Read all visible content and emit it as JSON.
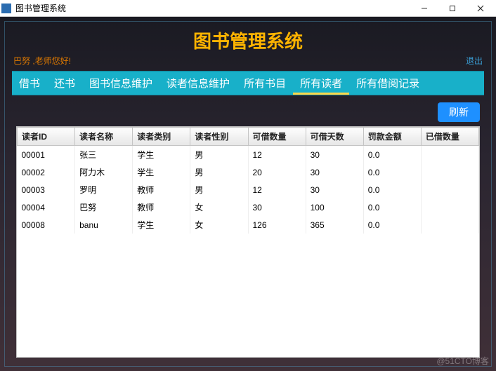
{
  "window": {
    "title": "图书管理系统"
  },
  "app": {
    "title": "图书管理系统",
    "greeting": "巴努 ,老师您好!",
    "exit": "退出"
  },
  "tabs": {
    "items": [
      {
        "label": "借书"
      },
      {
        "label": "还书"
      },
      {
        "label": "图书信息维护"
      },
      {
        "label": "读者信息维护"
      },
      {
        "label": "所有书目"
      },
      {
        "label": "所有读者"
      },
      {
        "label": "所有借阅记录"
      }
    ],
    "active_index": 5
  },
  "actions": {
    "refresh": "刷新"
  },
  "table": {
    "columns": [
      "读者ID",
      "读者名称",
      "读者类别",
      "读者性别",
      "可借数量",
      "可借天数",
      "罚款金额",
      "已借数量"
    ],
    "rows": [
      {
        "id": "00001",
        "name": "张三",
        "cat": "学生",
        "sex": "男",
        "borrow_qty": "12",
        "borrow_days": "30",
        "fine": "0.0",
        "borrowed": ""
      },
      {
        "id": "00002",
        "name": "阿力木",
        "cat": "学生",
        "sex": "男",
        "borrow_qty": "20",
        "borrow_days": "30",
        "fine": "0.0",
        "borrowed": ""
      },
      {
        "id": "00003",
        "name": "罗明",
        "cat": "教师",
        "sex": "男",
        "borrow_qty": "12",
        "borrow_days": "30",
        "fine": "0.0",
        "borrowed": ""
      },
      {
        "id": "00004",
        "name": "巴努",
        "cat": "教师",
        "sex": "女",
        "borrow_qty": "30",
        "borrow_days": "100",
        "fine": "0.0",
        "borrowed": ""
      },
      {
        "id": "00008",
        "name": "banu",
        "cat": "学生",
        "sex": "女",
        "borrow_qty": "126",
        "borrow_days": "365",
        "fine": "0.0",
        "borrowed": ""
      }
    ]
  },
  "watermark": "@51CTO博客"
}
